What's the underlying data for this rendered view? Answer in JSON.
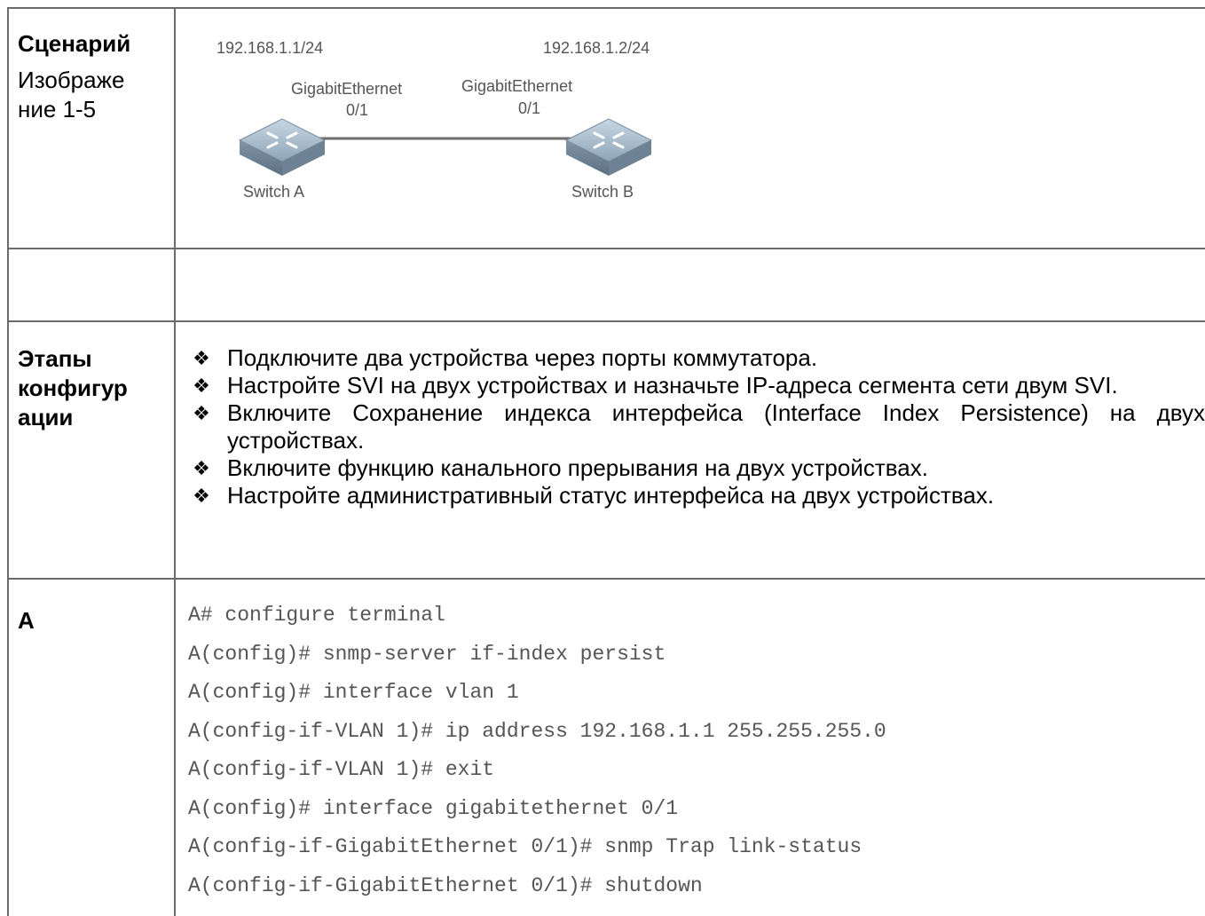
{
  "scenario": {
    "title": "Сценарий",
    "figure_label": "Изображе ние 1-5"
  },
  "diagram": {
    "switch_a": {
      "ip": "192.168.1.1/24",
      "port_line1": "GigabitEthernet",
      "port_line2": "0/1",
      "name": "Switch A"
    },
    "switch_b": {
      "ip": "192.168.1.2/24",
      "port_line1": "GigabitEthernet",
      "port_line2": "0/1",
      "name": "Switch B"
    },
    "icon": "network-switch-icon"
  },
  "steps": {
    "label": "Этапы конфигур ации",
    "bullet": "❖",
    "items": [
      "Подключите два устройства через порты коммутатора.",
      "Настройте SVI на двух устройствах и назначьте IP-адреса сегмента сети двум SVI.",
      "Включите Сохранение индекса интерфейса (Interface Index Persistence) на двух устройствах.",
      "Включите функцию канального прерывания на двух устройствах.",
      "Настройте административный статус интерфейса на двух устройствах."
    ]
  },
  "config_a": {
    "label": "A",
    "lines": [
      "A# configure terminal",
      "A(config)# snmp-server if-index persist",
      "A(config)# interface vlan 1",
      "A(config-if-VLAN 1)# ip address 192.168.1.1 255.255.255.0",
      "A(config-if-VLAN 1)# exit",
      "A(config)# interface gigabitethernet 0/1",
      "A(config-if-GigabitEthernet 0/1)# snmp Trap link-status",
      "A(config-if-GigabitEthernet 0/1)# shutdown"
    ]
  }
}
